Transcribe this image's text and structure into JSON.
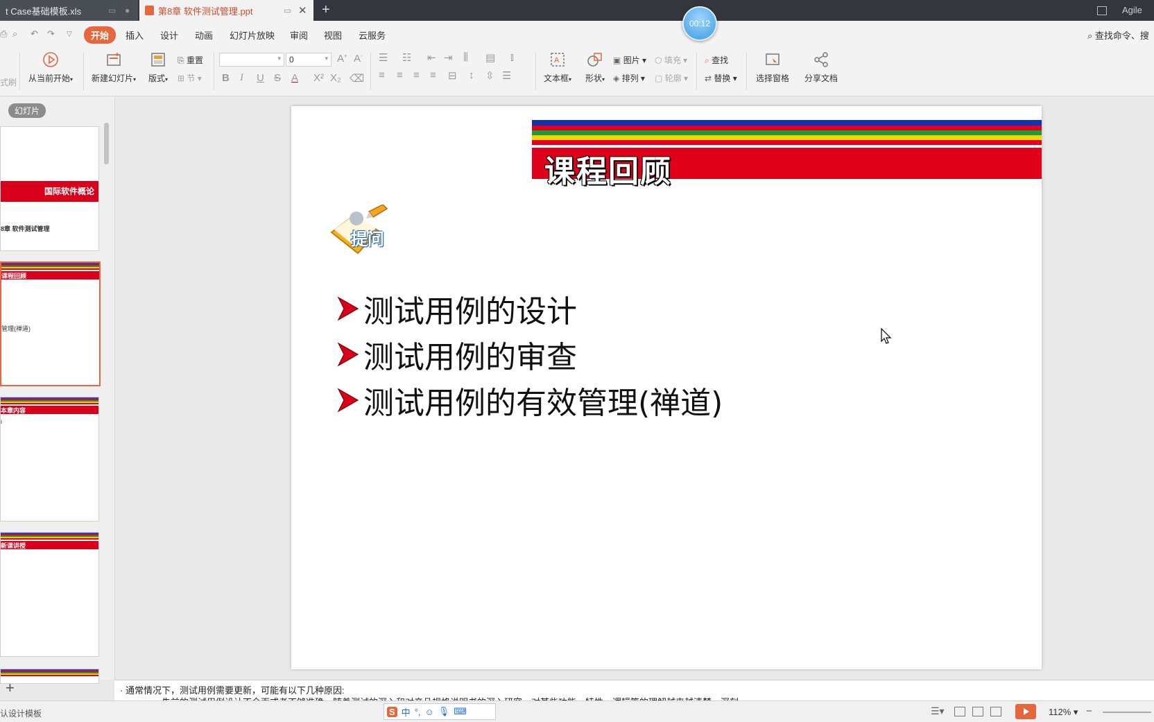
{
  "tabs": [
    {
      "label": "t Case基础模板.xls"
    },
    {
      "label": "第8章 软件测试管理.ppt"
    }
  ],
  "timer": "00:12",
  "user": "Agile",
  "menu": {
    "items": [
      "开始",
      "插入",
      "设计",
      "动画",
      "幻灯片放映",
      "审阅",
      "视图",
      "云服务"
    ],
    "search": "查找命令、搜"
  },
  "ribbon": {
    "format_label": "式刷",
    "play_from_current": "从当前开始",
    "new_slide": "新建幻灯片",
    "layout": "版式",
    "reset": "重置",
    "section": "节",
    "font_size": "0",
    "textbox": "文本框",
    "shape": "形状",
    "picture": "图片",
    "fill": "填充",
    "arrange": "排列",
    "outline": "轮廓",
    "find": "查找",
    "replace": "替换",
    "select_pane": "选择窗格",
    "share": "分享文档"
  },
  "left_panel": {
    "tab": "幻灯片",
    "thumbs": [
      {
        "bar": "国际软件概论",
        "text": "8章  软件测试管理"
      },
      {
        "bar": "课程回顾",
        "text": "管理(禅道)"
      },
      {
        "bar": "本章内容",
        "text": ""
      },
      {
        "bar": "新课讲授",
        "text": ""
      }
    ]
  },
  "slide": {
    "title": "课程回顾",
    "badge": "提问",
    "bullets": [
      "测试用例的设计",
      "测试用例的审查",
      "测试用例的有效管理(禅道)"
    ]
  },
  "notes": {
    "line1": "· 通常情况下，测试用例需要更新，可能有以下几种原因:",
    "line2": "· 先前的测试用例设计不全面或者不够准确，随着测试的深入和对产品规格说明书的深入研究，对某些功能、特性、逻辑等的理解越来越清楚、深刻"
  },
  "status": {
    "template": "认设计模板",
    "zoom": "112%"
  },
  "colors": {
    "accent": "#e8663c",
    "title_red": "#e0001a"
  }
}
